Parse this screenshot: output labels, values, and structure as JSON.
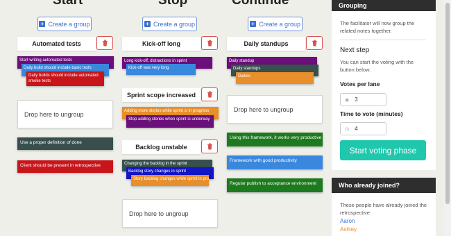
{
  "columns": [
    {
      "title": "Start",
      "create_label": "Create a group"
    },
    {
      "title": "Stop",
      "create_label": "Create a group"
    },
    {
      "title": "Continue",
      "create_label": "Create a group"
    }
  ],
  "start": {
    "group_title": "Automated tests",
    "notes": [
      "Start writing automated tests",
      "Daily build should include basic tests",
      "Daily builds should include automated smoke tests"
    ],
    "drop_label": "Drop here to ungroup",
    "free_notes": [
      "Use a proper definition of done",
      "Client should be present in retrospective"
    ]
  },
  "stop": {
    "group1_title": "Kick-off long",
    "group1_notes": [
      "Long kick-off, distractions in sprint",
      "Kick-off was very long"
    ],
    "group2_title": "Sprint scope increased",
    "group2_notes": [
      "Adding more stories while sprint is in progress",
      "Stop adding stories when sprint is underway"
    ],
    "group3_title": "Backlog unstable",
    "group3_notes": [
      "Changing the backlog in the sprint",
      "Backlog story changes in sprint",
      "Story backlog changes while sprint in progress"
    ],
    "drop_label": "Drop here to ungroup"
  },
  "continue": {
    "group_title": "Daily standups",
    "notes": [
      "Daily standup",
      "Daily standups",
      "Dailies"
    ],
    "drop_label": "Drop here to ungroup",
    "free_notes": [
      "Using this framework, it works very productive",
      "Framework with good productivity",
      "Regular publish to acceptance environment"
    ]
  },
  "panel": {
    "grouping_title": "Grouping",
    "grouping_text": "The facilitator will now group the related notes together.",
    "next_step_title": "Next step",
    "next_step_text": "You can start the voting with the button below.",
    "votes_label": "Votes per lane",
    "votes_value": "3",
    "time_label": "Time to vote (minutes)",
    "time_value": "4",
    "start_button": "Start voting phase",
    "joined_title": "Who already joined?",
    "joined_text": "These people have already joined the retrospective:",
    "people": [
      {
        "name": "Aaron",
        "color": "#3a6fe0"
      },
      {
        "name": "Ashley",
        "color": "#e88e2a"
      }
    ]
  },
  "colors": {
    "purple": "#6b0f7a",
    "blue": "#3a88dd",
    "red": "#c8151b",
    "slate": "#38504d",
    "orange": "#e88e2a",
    "green": "#1e7a1e",
    "navy": "#1414c8",
    "accent": "#1fc7ad"
  }
}
